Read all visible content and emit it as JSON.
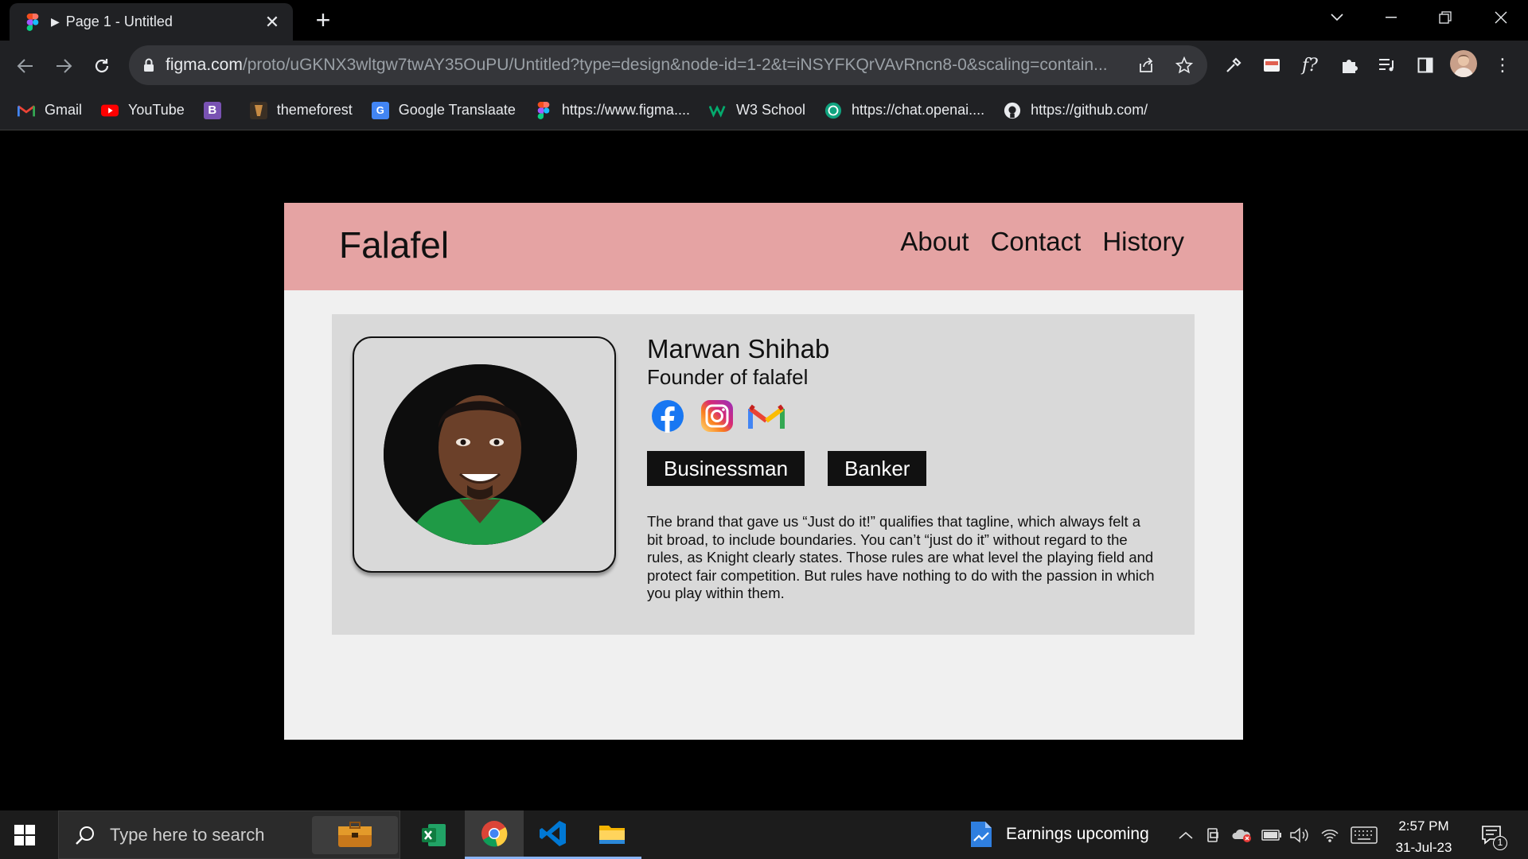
{
  "browser": {
    "tab_title": "Page 1 - Untitled",
    "url_domain": "figma.com",
    "url_path": "/proto/uGKNX3wltgw7twAY35OuPU/Untitled?type=design&node-id=1-2&t=iNSYFKQrVAvRncn8-0&scaling=contain...",
    "bookmarks": [
      {
        "label": "Gmail",
        "icon": "gmail-icon"
      },
      {
        "label": "YouTube",
        "icon": "youtube-icon"
      },
      {
        "label": "",
        "icon": "bootstrap-icon"
      },
      {
        "label": "themeforest",
        "icon": "themeforest-icon"
      },
      {
        "label": "Google Translaate",
        "icon": "google-translate-icon"
      },
      {
        "label": "https://www.figma....",
        "icon": "figma-icon"
      },
      {
        "label": "W3 School",
        "icon": "w3school-icon"
      },
      {
        "label": "https://chat.openai....",
        "icon": "openai-icon"
      },
      {
        "label": "https://github.com/",
        "icon": "github-icon"
      }
    ]
  },
  "site": {
    "logo": "Falafel",
    "nav": [
      "About",
      "Contact",
      "History"
    ],
    "header_color": "#e5a3a3"
  },
  "profile": {
    "name": "Marwan Shihab",
    "role": "Founder of falafel",
    "socials": [
      "facebook-icon",
      "instagram-icon",
      "gmail-icon"
    ],
    "tags": [
      "Businessman",
      "Banker"
    ],
    "bio": "The brand that gave us “Just do it!” qualifies that tagline, which always felt a bit broad, to include boundaries. You can’t “just do it” without regard to the rules, as Knight clearly states. Those rules are what level the playing field and protect fair competition. But rules have nothing to do with the passion in which you play within them."
  },
  "taskbar": {
    "search_placeholder": "Type here to search",
    "news": "Earnings upcoming",
    "time": "2:57 PM",
    "date": "31-Jul-23",
    "notification_count": "1"
  }
}
